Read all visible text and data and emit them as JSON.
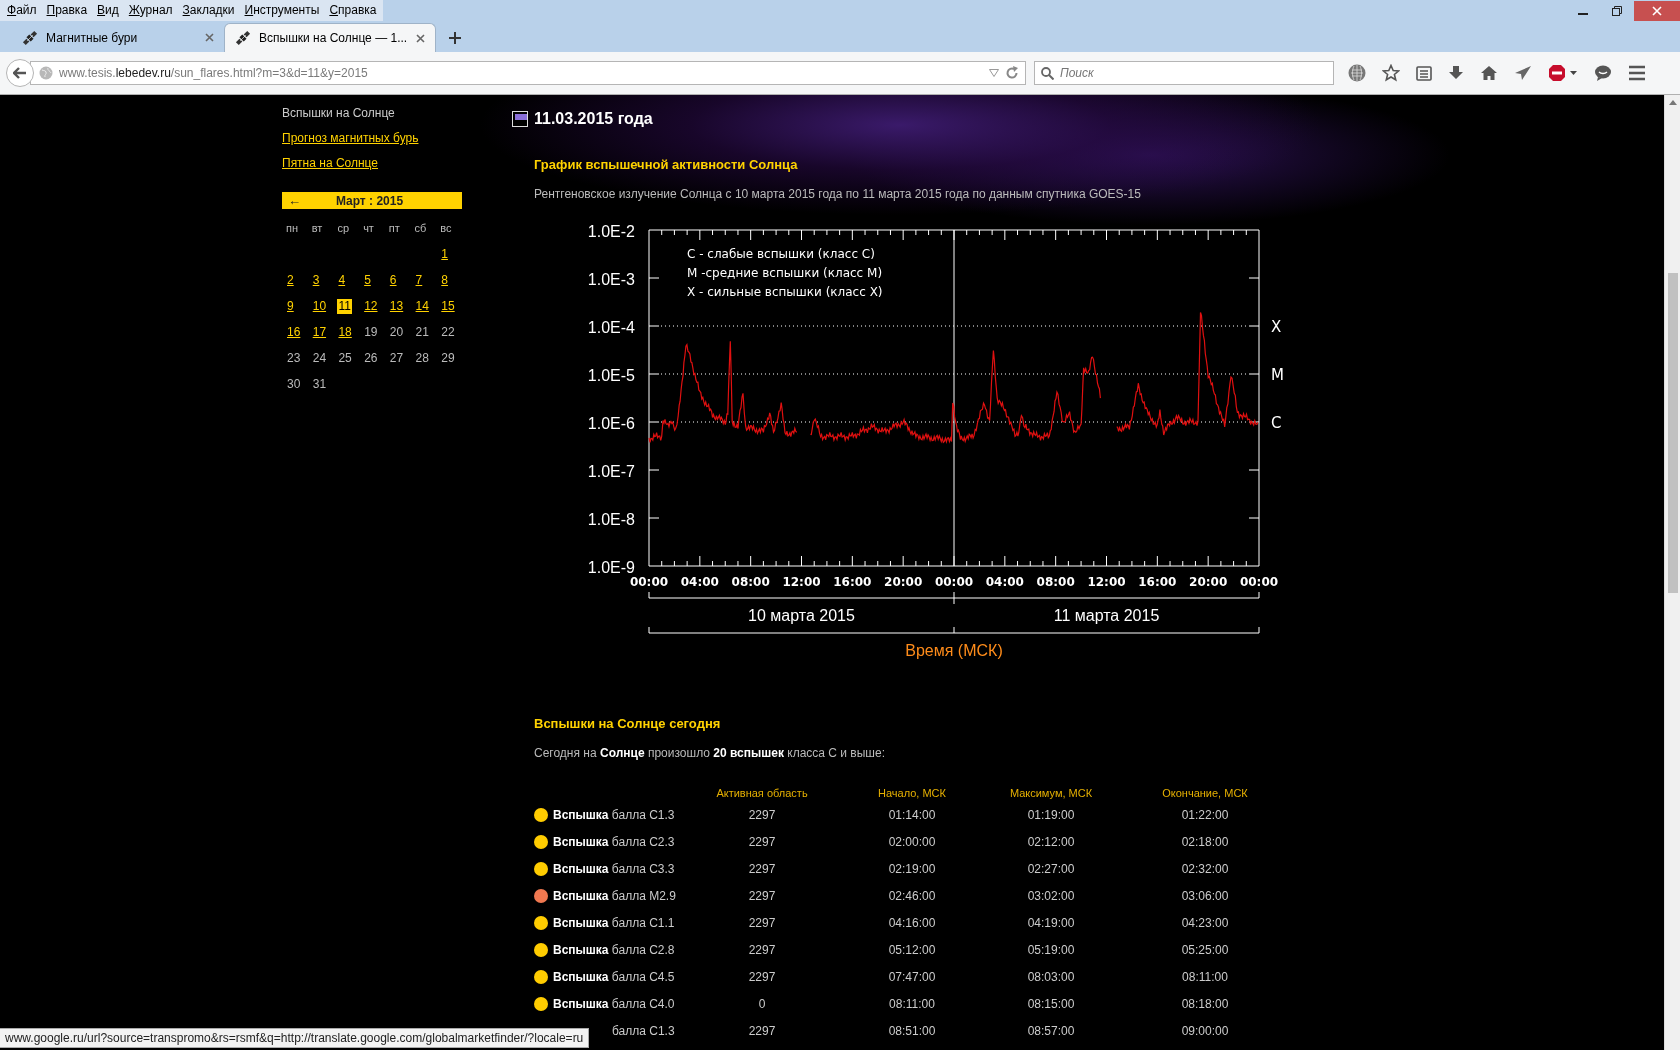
{
  "menu": [
    "Файл",
    "Правка",
    "Вид",
    "Журнал",
    "Закладки",
    "Инструменты",
    "Справка"
  ],
  "tabs": [
    {
      "title": "Магнитные бури",
      "selected": false
    },
    {
      "title": "Вспышки на Солнце — 1...",
      "selected": true
    }
  ],
  "address": {
    "url": "www.tesis.**lebedev.ru**/sun_flares.html?m=3&d=11&y=2015"
  },
  "search": {
    "placeholder": "Поиск"
  },
  "sidebar": {
    "items": [
      {
        "label": "Вспышки на Солнце",
        "selected": true
      },
      {
        "label": "Прогноз магнитных бурь",
        "selected": false
      },
      {
        "label": "Пятна на Солнце",
        "selected": false
      }
    ]
  },
  "calendar": {
    "prev": "←",
    "title": "Март : 2015",
    "weekdays": [
      "пн",
      "вт",
      "ср",
      "чт",
      "пт",
      "сб",
      "вс"
    ],
    "weeks": [
      [
        {
          "label": "1",
          "link": true,
          "selected": false
        }
      ],
      [
        {
          "label": "2",
          "link": true,
          "selected": false
        },
        {
          "label": "3",
          "link": true,
          "selected": false
        },
        {
          "label": "4",
          "link": true,
          "selected": false
        },
        {
          "label": "5",
          "link": true,
          "selected": false
        },
        {
          "label": "6",
          "link": true,
          "selected": false
        },
        {
          "label": "7",
          "link": true,
          "selected": false
        },
        {
          "label": "8",
          "link": true,
          "selected": false
        }
      ],
      [
        {
          "label": "9",
          "link": true,
          "selected": false
        },
        {
          "label": "10",
          "link": true,
          "selected": false
        },
        {
          "label": "11",
          "link": true,
          "selected": true
        },
        {
          "label": "12",
          "link": true,
          "selected": false
        },
        {
          "label": "13",
          "link": true,
          "selected": false
        },
        {
          "label": "14",
          "link": true,
          "selected": false
        },
        {
          "label": "15",
          "link": true,
          "selected": false
        }
      ],
      [
        {
          "label": "16",
          "link": true,
          "selected": false
        },
        {
          "label": "17",
          "link": true,
          "selected": false
        },
        {
          "label": "18",
          "link": true,
          "selected": false
        },
        {
          "label": "19",
          "link": false,
          "selected": false
        },
        {
          "label": "20",
          "link": false,
          "selected": false
        },
        {
          "label": "21",
          "link": false,
          "selected": false
        },
        {
          "label": "22",
          "link": false,
          "selected": false
        }
      ],
      [
        {
          "label": "23",
          "link": false,
          "selected": false
        },
        {
          "label": "24",
          "link": false,
          "selected": false
        },
        {
          "label": "25",
          "link": false,
          "selected": false
        },
        {
          "label": "26",
          "link": false,
          "selected": false
        },
        {
          "label": "27",
          "link": false,
          "selected": false
        },
        {
          "label": "28",
          "link": false,
          "selected": false
        },
        {
          "label": "29",
          "link": false,
          "selected": false
        }
      ],
      [
        {
          "label": "30",
          "link": false,
          "selected": false
        },
        {
          "label": "31",
          "link": false,
          "selected": false
        }
      ]
    ]
  },
  "page": {
    "date": "11.03.2015 года",
    "chart_title": "График вспышечной активности Солнца",
    "chart_subtitle": "Рентгеновское излучение Солнца с 10 марта 2015 года по 11 марта 2015 года по данным спутника GOES-15"
  },
  "chart": {
    "y_labels": [
      "1.0E-2",
      "1.0E-3",
      "1.0E-4",
      "1.0E-5",
      "1.0E-6",
      "1.0E-7",
      "1.0E-8",
      "1.0E-9"
    ],
    "x_labels": [
      "00:00",
      "04:00",
      "08:00",
      "12:00",
      "16:00",
      "20:00",
      "00:00",
      "04:00",
      "08:00",
      "12:00",
      "16:00",
      "20:00",
      "00:00"
    ],
    "legend": [
      "C - слабые вспышки (класс C)",
      "M -средние вспышки (класс M)",
      "X - сильные вспышки (класс X)"
    ],
    "class_labels": [
      "X",
      "M",
      "C"
    ],
    "days": [
      "10 марта 2015",
      "11 марта 2015"
    ],
    "xlabel": "Время (МСК)"
  },
  "flares": {
    "title": "Вспышки на Солнце сегодня",
    "summary": "Сегодня на **Солнце** произошло **20 вспышек** класса C и выше:",
    "columns": [
      "Активная область",
      "Начало, МСК",
      "Максимум, МСК",
      "Окончание, МСК"
    ],
    "rows": [
      {
        "color": "#ffcc00",
        "label": "**Вспышка** балла C1.3",
        "region": "2297",
        "start": "01:14:00",
        "max": "01:19:00",
        "end": "01:22:00"
      },
      {
        "color": "#ffcc00",
        "label": "**Вспышка** балла C2.3",
        "region": "2297",
        "start": "02:00:00",
        "max": "02:12:00",
        "end": "02:18:00"
      },
      {
        "color": "#ffcc00",
        "label": "**Вспышка** балла C3.3",
        "region": "2297",
        "start": "02:19:00",
        "max": "02:27:00",
        "end": "02:32:00"
      },
      {
        "color": "#f07850",
        "label": "**Вспышка** балла M2.9",
        "region": "2297",
        "start": "02:46:00",
        "max": "03:02:00",
        "end": "03:06:00"
      },
      {
        "color": "#ffcc00",
        "label": "**Вспышка** балла C1.1",
        "region": "2297",
        "start": "04:16:00",
        "max": "04:19:00",
        "end": "04:23:00"
      },
      {
        "color": "#ffcc00",
        "label": "**Вспышка** балла C2.8",
        "region": "2297",
        "start": "05:12:00",
        "max": "05:19:00",
        "end": "05:25:00"
      },
      {
        "color": "#ffcc00",
        "label": "**Вспышка** балла C4.5",
        "region": "2297",
        "start": "07:47:00",
        "max": "08:03:00",
        "end": "08:11:00"
      },
      {
        "color": "#ffcc00",
        "label": "**Вспышка** балла C4.0",
        "region": "0",
        "start": "08:11:00",
        "max": "08:15:00",
        "end": "08:18:00"
      },
      {
        "label": "балла C1.3",
        "region": "2297",
        "start": "08:51:00",
        "max": "08:57:00",
        "end": "09:00:00"
      }
    ]
  },
  "status_bar": "www.google.ru/url?source=transpromo&rs=rsmf&q=http://translate.google.com/globalmarketfinder/?locale=ru"
}
